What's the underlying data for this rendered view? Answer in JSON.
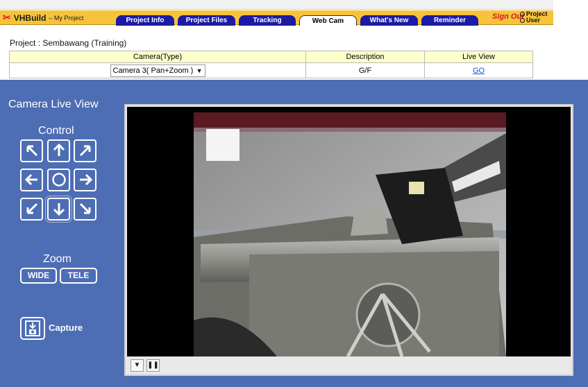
{
  "header": {
    "brand_name": "VHBuild",
    "brand_sub": "– My Project",
    "tabs": [
      "Project Info",
      "Project Files",
      "Tracking",
      "Web Cam",
      "What's New",
      "Reminder"
    ],
    "sign_out": "Sign Out",
    "user_options": [
      "Project",
      "User"
    ]
  },
  "project": {
    "line": "Project : Sembawang (Training)",
    "table": {
      "headers": [
        "Camera(Type)",
        "Description",
        "Live View"
      ],
      "camera_value": "Camera 3( Pan+Zoom )",
      "description": "G/F",
      "live_view_link": "GO"
    }
  },
  "controls": {
    "title": "Camera Live View",
    "control_label": "Control",
    "zoom_label": "Zoom",
    "zoom_wide": "WIDE",
    "zoom_tele": "TELE",
    "capture_label": "Capture"
  },
  "colors": {
    "panel_blue": "#4d6db4",
    "nav_yellow": "#f7c33b",
    "tab_blue": "#1b1ba3",
    "table_header": "#ffffcc"
  }
}
